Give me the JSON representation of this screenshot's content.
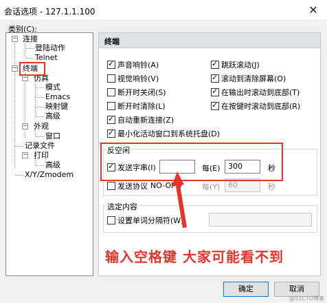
{
  "window": {
    "title": "会话选项 - 127.1.1.100",
    "close_glyph": "✕"
  },
  "category_label": "类别(C):",
  "tree": {
    "connection": "连接",
    "login_actions": "登陆动作",
    "telnet": "Telnet",
    "terminal": "终端",
    "emulation": "仿真",
    "modes": "模式",
    "emacs": "Emacs",
    "mapped_keys": "映射键",
    "advanced": "高级",
    "appearance": "外观",
    "window": "窗口",
    "log_file": "记录文件",
    "printing": "打印",
    "print_advanced": "高级",
    "xyzmodem": "X/Y/Zmodem",
    "expand_glyph": "−"
  },
  "panel": {
    "title": "终端",
    "options": {
      "audio_bell": "声音响铃(A)",
      "visual_bell": "视觉响铃(V)",
      "close_on_disconnect": "断开时关闭(S)",
      "clear_on_disconnect": "断开时清除(L)",
      "auto_reconnect": "自动重新连接(Z)",
      "minimize_to_tray": "最小化活动窗口到系统托盘(D)",
      "jump_scroll": "跳跃滚动(J)",
      "scroll_to_clear": "滚动到清除屏幕(O)",
      "scroll_on_output": "在输出时滚动到底部(T)",
      "scroll_on_keypress": "在按键时滚动到底部(R)"
    },
    "anti_idle": {
      "title": "反空闲",
      "send_string_label": "发送字串(I)",
      "send_string_value": "",
      "every_label": "每(E)",
      "every_value": "300",
      "seconds_label": "秒",
      "send_protocol_label": "发送协议",
      "protocol_value": "NO-OP",
      "every2_label": "每(Y)",
      "every2_value": "60",
      "seconds2_label": "秒"
    },
    "selection": {
      "title": "选定内容",
      "word_delimiters_label": "设置单词分隔符(W):",
      "word_delimiters_value": ""
    }
  },
  "annotation": "输入空格键 大家可能看不到",
  "buttons": {
    "ok": "确定",
    "cancel": "取消"
  },
  "watermark": "@51CTO博客",
  "colors": {
    "annotation_red": "#e8332a",
    "panel_header": "#dfe3e8"
  }
}
